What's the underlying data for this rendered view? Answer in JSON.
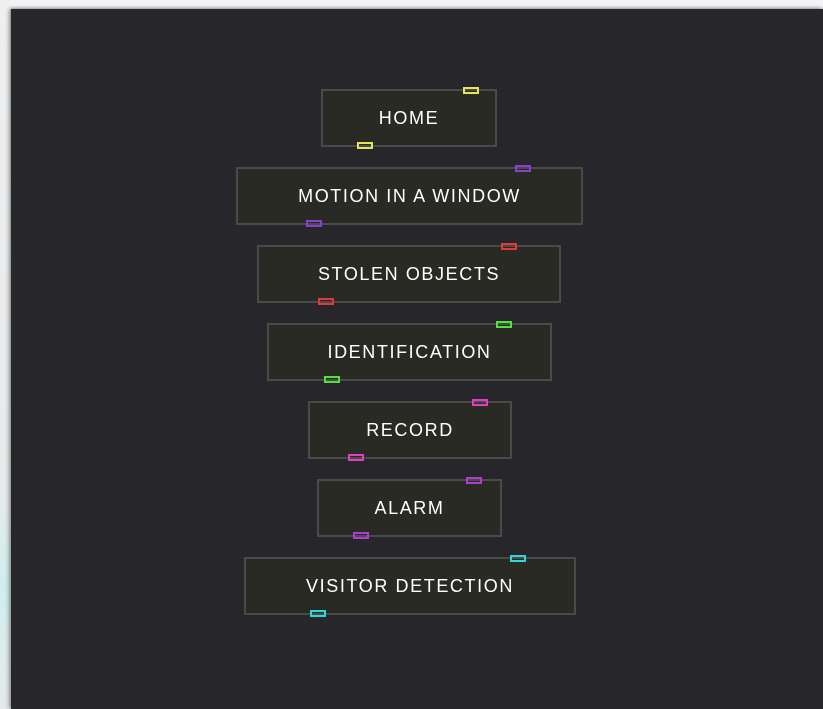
{
  "menu": {
    "items": [
      {
        "label": "HOME",
        "accent": "#e6e45a"
      },
      {
        "label": "MOTION IN A WINDOW",
        "accent": "#8a3fd1"
      },
      {
        "label": "STOLEN OBJECTS",
        "accent": "#e2383a"
      },
      {
        "label": "IDENTIFICATION",
        "accent": "#4ee23b"
      },
      {
        "label": "RECORD",
        "accent": "#e040c0"
      },
      {
        "label": "ALARM",
        "accent": "#b23bd8"
      },
      {
        "label": "VISITOR DETECTION",
        "accent": "#2fd6da"
      }
    ]
  }
}
